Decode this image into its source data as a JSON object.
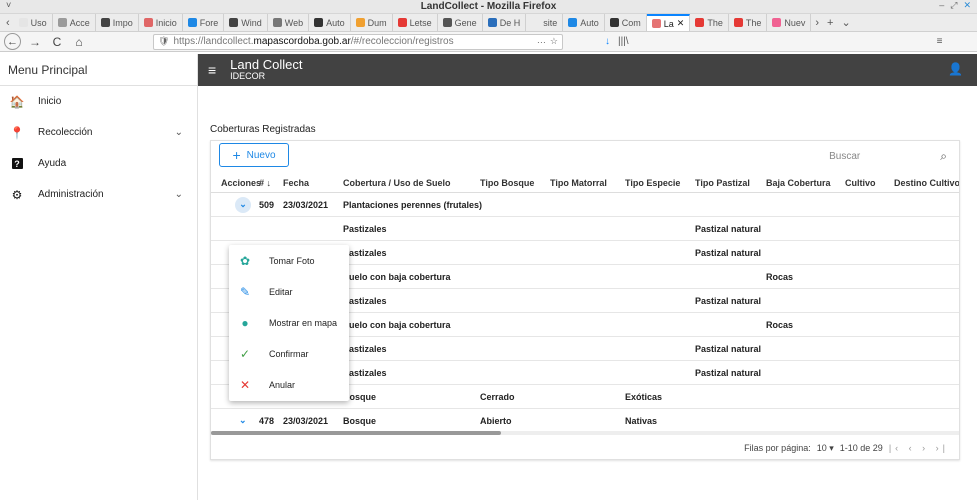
{
  "window": {
    "title": "LandCollect - Mozilla Firefox",
    "menu_glyph": "˅",
    "controls": [
      "‒",
      "⤢",
      "✕"
    ]
  },
  "tabs": [
    {
      "label": "Uso",
      "color": "#e5e5e5"
    },
    {
      "label": "Acce",
      "color": "#9b9b9b"
    },
    {
      "label": "Impo",
      "color": "#444444"
    },
    {
      "label": "Inicio",
      "color": "#e06666"
    },
    {
      "label": "Fore",
      "color": "#1e88e5"
    },
    {
      "label": "Wind",
      "color": "#444444"
    },
    {
      "label": "Web",
      "color": "#777777"
    },
    {
      "label": "Auto",
      "color": "#333333"
    },
    {
      "label": "Dum",
      "color": "#f0a030"
    },
    {
      "label": "Letse",
      "color": "#e53935"
    },
    {
      "label": "Gene",
      "color": "#555555"
    },
    {
      "label": "De H",
      "color": "#2a6ebb"
    },
    {
      "label": "site",
      "color": "#ececec"
    },
    {
      "label": "Auto",
      "color": "#1e88e5"
    },
    {
      "label": "Com",
      "color": "#333333"
    },
    {
      "label": "La",
      "color": "#e57373",
      "active": true
    },
    {
      "label": "The",
      "color": "#e53935"
    },
    {
      "label": "The",
      "color": "#e53935"
    },
    {
      "label": "Nuev",
      "color": "#f06292"
    }
  ],
  "tab_overflow": "›",
  "tab_new": "+",
  "tab_list": "⌄",
  "nav": {
    "back": "←",
    "forward": "→",
    "reload": "C",
    "home": "⌂",
    "url_prefix": "https://landcollect.",
    "url_domain": "mapascordoba.gob.ar",
    "url_suffix": "/#/recoleccion/registros",
    "url_more": "···",
    "star": "☆",
    "shield": "🛡",
    "download": "↓",
    "library": "|||\\",
    "menu": "≡"
  },
  "sidebar": {
    "title": "Menu Principal",
    "items": [
      {
        "label": "Inicio",
        "icon": "home-icon",
        "glyph": "🏠"
      },
      {
        "label": "Recolección",
        "icon": "pin-icon",
        "glyph": "📍",
        "expandable": true
      },
      {
        "label": "Ayuda",
        "icon": "help-icon",
        "glyph": "?"
      },
      {
        "label": "Administración",
        "icon": "settings-icon",
        "glyph": "⚙",
        "expandable": true
      }
    ]
  },
  "topbar": {
    "title": "Land Collect",
    "subtitle": "IDECOR",
    "menu_glyph": "≡",
    "account_glyph": "👤"
  },
  "section_title": "Coberturas Registradas",
  "toolbar": {
    "new_label": "Nuevo",
    "search_placeholder": "Buscar"
  },
  "table": {
    "columns": [
      "Acciones",
      "# ↓",
      "Fecha",
      "Cobertura / Uso de Suelo",
      "Tipo Bosque",
      "Tipo Matorral",
      "Tipo Especie",
      "Tipo Pastizal",
      "Baja Cobertura",
      "Cultivo",
      "Destino Cultivo"
    ],
    "rows": [
      {
        "id": "509",
        "fecha": "23/03/2021",
        "cobertura": "Plantaciones perennes (frutales)",
        "bosque": "",
        "matorral": "",
        "especie": "",
        "pastizal": "",
        "baja": "",
        "open": true
      },
      {
        "id": "",
        "fecha": "",
        "cobertura": "Pastizales",
        "bosque": "",
        "matorral": "",
        "especie": "",
        "pastizal": "Pastizal natural",
        "baja": ""
      },
      {
        "id": "",
        "fecha": "",
        "cobertura": "Pastizales",
        "bosque": "",
        "matorral": "",
        "especie": "",
        "pastizal": "Pastizal natural",
        "baja": ""
      },
      {
        "id": "",
        "fecha": "",
        "cobertura": "Suelo con baja cobertura",
        "bosque": "",
        "matorral": "",
        "especie": "",
        "pastizal": "",
        "baja": "Rocas"
      },
      {
        "id": "",
        "fecha": "",
        "cobertura": "Pastizales",
        "bosque": "",
        "matorral": "",
        "especie": "",
        "pastizal": "Pastizal natural",
        "baja": ""
      },
      {
        "id": "",
        "fecha": "",
        "cobertura": "Suelo con baja cobertura",
        "bosque": "",
        "matorral": "",
        "especie": "",
        "pastizal": "",
        "baja": "Rocas"
      },
      {
        "id": "",
        "fecha": "",
        "cobertura": "Pastizales",
        "bosque": "",
        "matorral": "",
        "especie": "",
        "pastizal": "Pastizal natural",
        "baja": ""
      },
      {
        "id": "490",
        "fecha": "23/03/2021",
        "cobertura": "Pastizales",
        "bosque": "",
        "matorral": "",
        "especie": "",
        "pastizal": "Pastizal natural",
        "baja": ""
      },
      {
        "id": "484",
        "fecha": "23/03/2021",
        "cobertura": "Bosque",
        "bosque": "Cerrado",
        "matorral": "",
        "especie": "Exóticas",
        "pastizal": "",
        "baja": ""
      },
      {
        "id": "478",
        "fecha": "23/03/2021",
        "cobertura": "Bosque",
        "bosque": "Abierto",
        "matorral": "",
        "especie": "Nativas",
        "pastizal": "",
        "baja": ""
      }
    ]
  },
  "action_menu": [
    {
      "label": "Tomar Foto",
      "icon": "camera-icon",
      "glyph": "✿",
      "color": "#26a69a"
    },
    {
      "label": "Editar",
      "icon": "pencil-icon",
      "glyph": "✎",
      "color": "#1e88e5"
    },
    {
      "label": "Mostrar en mapa",
      "icon": "map-pin-icon",
      "glyph": "●",
      "color": "#26a69a"
    },
    {
      "label": "Confirmar",
      "icon": "check-icon",
      "glyph": "✓",
      "color": "#43a047"
    },
    {
      "label": "Anular",
      "icon": "close-icon",
      "glyph": "✕",
      "color": "#e53935"
    }
  ],
  "pagination": {
    "rows_label": "Filas por página:",
    "rows_value": "10",
    "dropdown_glyph": "▾",
    "range": "1-10 de 29",
    "nav_glyphs": "|‹ ‹ › ›|"
  },
  "colors": {
    "accent": "#1e88e5",
    "topbar": "#424242"
  }
}
